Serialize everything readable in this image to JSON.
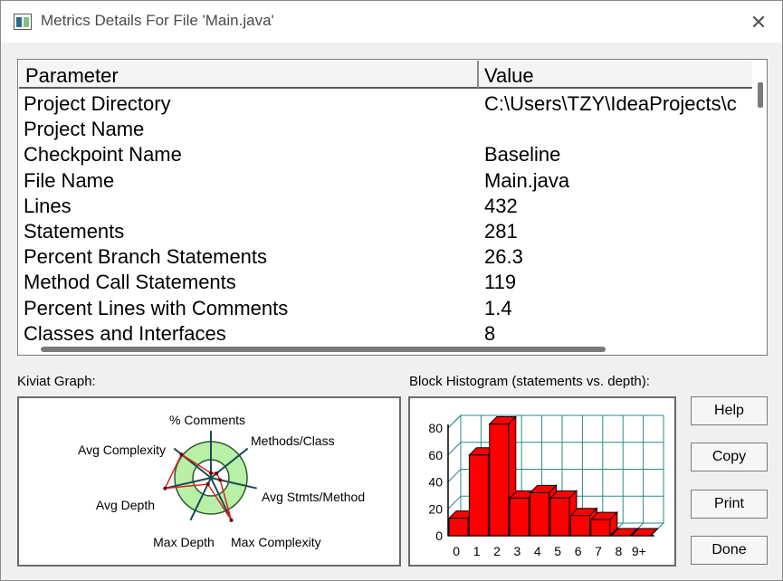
{
  "window": {
    "title": "Metrics Details For File 'Main.java'"
  },
  "table": {
    "headers": {
      "parameter": "Parameter",
      "value": "Value"
    },
    "rows": [
      {
        "parameter": "Project Directory",
        "value": "C:\\Users\\TZY\\IdeaProjects\\c"
      },
      {
        "parameter": "Project Name",
        "value": ""
      },
      {
        "parameter": "Checkpoint Name",
        "value": "Baseline"
      },
      {
        "parameter": "File Name",
        "value": "Main.java"
      },
      {
        "parameter": "Lines",
        "value": "432"
      },
      {
        "parameter": "Statements",
        "value": "281"
      },
      {
        "parameter": "Percent Branch Statements",
        "value": "26.3"
      },
      {
        "parameter": "Method Call Statements",
        "value": "119"
      },
      {
        "parameter": "Percent Lines with Comments",
        "value": "1.4"
      },
      {
        "parameter": "Classes and Interfaces",
        "value": "8"
      }
    ]
  },
  "kiviat": {
    "label": "Kiviat Graph:",
    "axes": [
      "% Comments",
      "Methods/Class",
      "Avg Stmts/Method",
      "Max Complexity",
      "Max Depth",
      "Avg Depth",
      "Avg Complexity"
    ],
    "relative_values": [
      0.1,
      0.15,
      0.2,
      1.0,
      0.15,
      1.0,
      0.8
    ],
    "colors": {
      "band": "#b8f0a8",
      "inner": "#ffffff",
      "polygon": "#e02020",
      "axis": "#1a4a55"
    }
  },
  "histogram": {
    "label": "Block Histogram (statements vs. depth):",
    "colors": {
      "bar": "#ff0000",
      "grid": "#2a8a8a"
    }
  },
  "chart_data": {
    "type": "bar",
    "title": "Block Histogram (statements vs. depth):",
    "categories": [
      "0",
      "1",
      "2",
      "3",
      "4",
      "5",
      "6",
      "7",
      "8",
      "9+"
    ],
    "values": [
      13,
      60,
      83,
      28,
      32,
      28,
      15,
      12,
      0,
      0
    ],
    "ylim": [
      0,
      80
    ],
    "yticks": [
      "0",
      "20",
      "40",
      "60",
      "80"
    ],
    "xlabel": "",
    "ylabel": "",
    "grid": true
  },
  "buttons": {
    "help": "Help",
    "copy": "Copy",
    "print": "Print",
    "done": "Done"
  }
}
